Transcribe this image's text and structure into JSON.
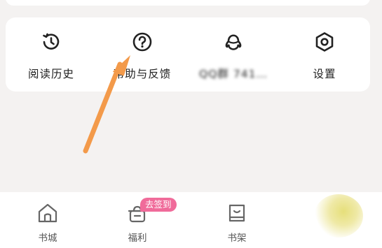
{
  "menu": {
    "items": [
      {
        "id": "history",
        "label": "阅读历史",
        "icon": "clock-history-icon"
      },
      {
        "id": "help",
        "label": "帮助与反馈",
        "icon": "question-circle-icon"
      },
      {
        "id": "group",
        "label": "QQ群 741…",
        "icon": "qq-penguin-icon"
      },
      {
        "id": "settings",
        "label": "设置",
        "icon": "hexagon-gear-icon"
      }
    ]
  },
  "tabbar": {
    "items": [
      {
        "id": "bookstore",
        "label": "书城",
        "icon": "house-icon"
      },
      {
        "id": "welfare",
        "label": "福利",
        "icon": "gift-pot-icon"
      },
      {
        "id": "bookshelf",
        "label": "书架",
        "icon": "smiley-book-icon"
      }
    ],
    "badge": "去签到"
  },
  "colors": {
    "background": "#f4f2f1",
    "card": "#ffffff",
    "badge": "#f06b9a",
    "annotation_arrow": "#f39a4a"
  }
}
